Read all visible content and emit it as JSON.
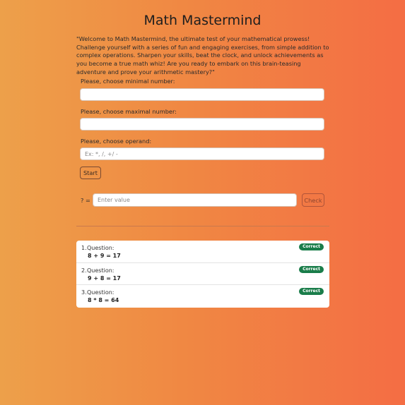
{
  "app": {
    "title": "Math Mastermind",
    "intro": "\"Welcome to Math Mastermind, the ultimate test of your mathematical prowess! Challenge yourself with a series of fun and engaging exercises, from simple addition to complex operations. Sharpen your skills, beat the clock, and unlock achievements as you become a true math whiz! Are you ready to embark on this brain-teasing adventure and prove your arithmetic mastery?\""
  },
  "form": {
    "min_label": "Please, choose minimal number:",
    "min_value": "",
    "max_label": "Please, choose maximal number:",
    "max_value": "",
    "operand_label": "Please, choose operand:",
    "operand_placeholder": "Ex: *, /, +/ -",
    "start_label": "Start"
  },
  "question": {
    "prompt": "? =",
    "answer_placeholder": "Enter value",
    "check_label": "Check"
  },
  "results": [
    {
      "num": "1.",
      "label": "Question:",
      "expr": "8 + 9 = 17",
      "status": "Correct"
    },
    {
      "num": "2.",
      "label": "Question:",
      "expr": "9 + 8 = 17",
      "status": "Correct"
    },
    {
      "num": "3.",
      "label": "Question:",
      "expr": "8 * 8 = 64",
      "status": "Correct"
    }
  ],
  "colors": {
    "badge_bg": "#1a7d4a",
    "gradient_start": "#eda04a",
    "gradient_end": "#f46d44"
  }
}
